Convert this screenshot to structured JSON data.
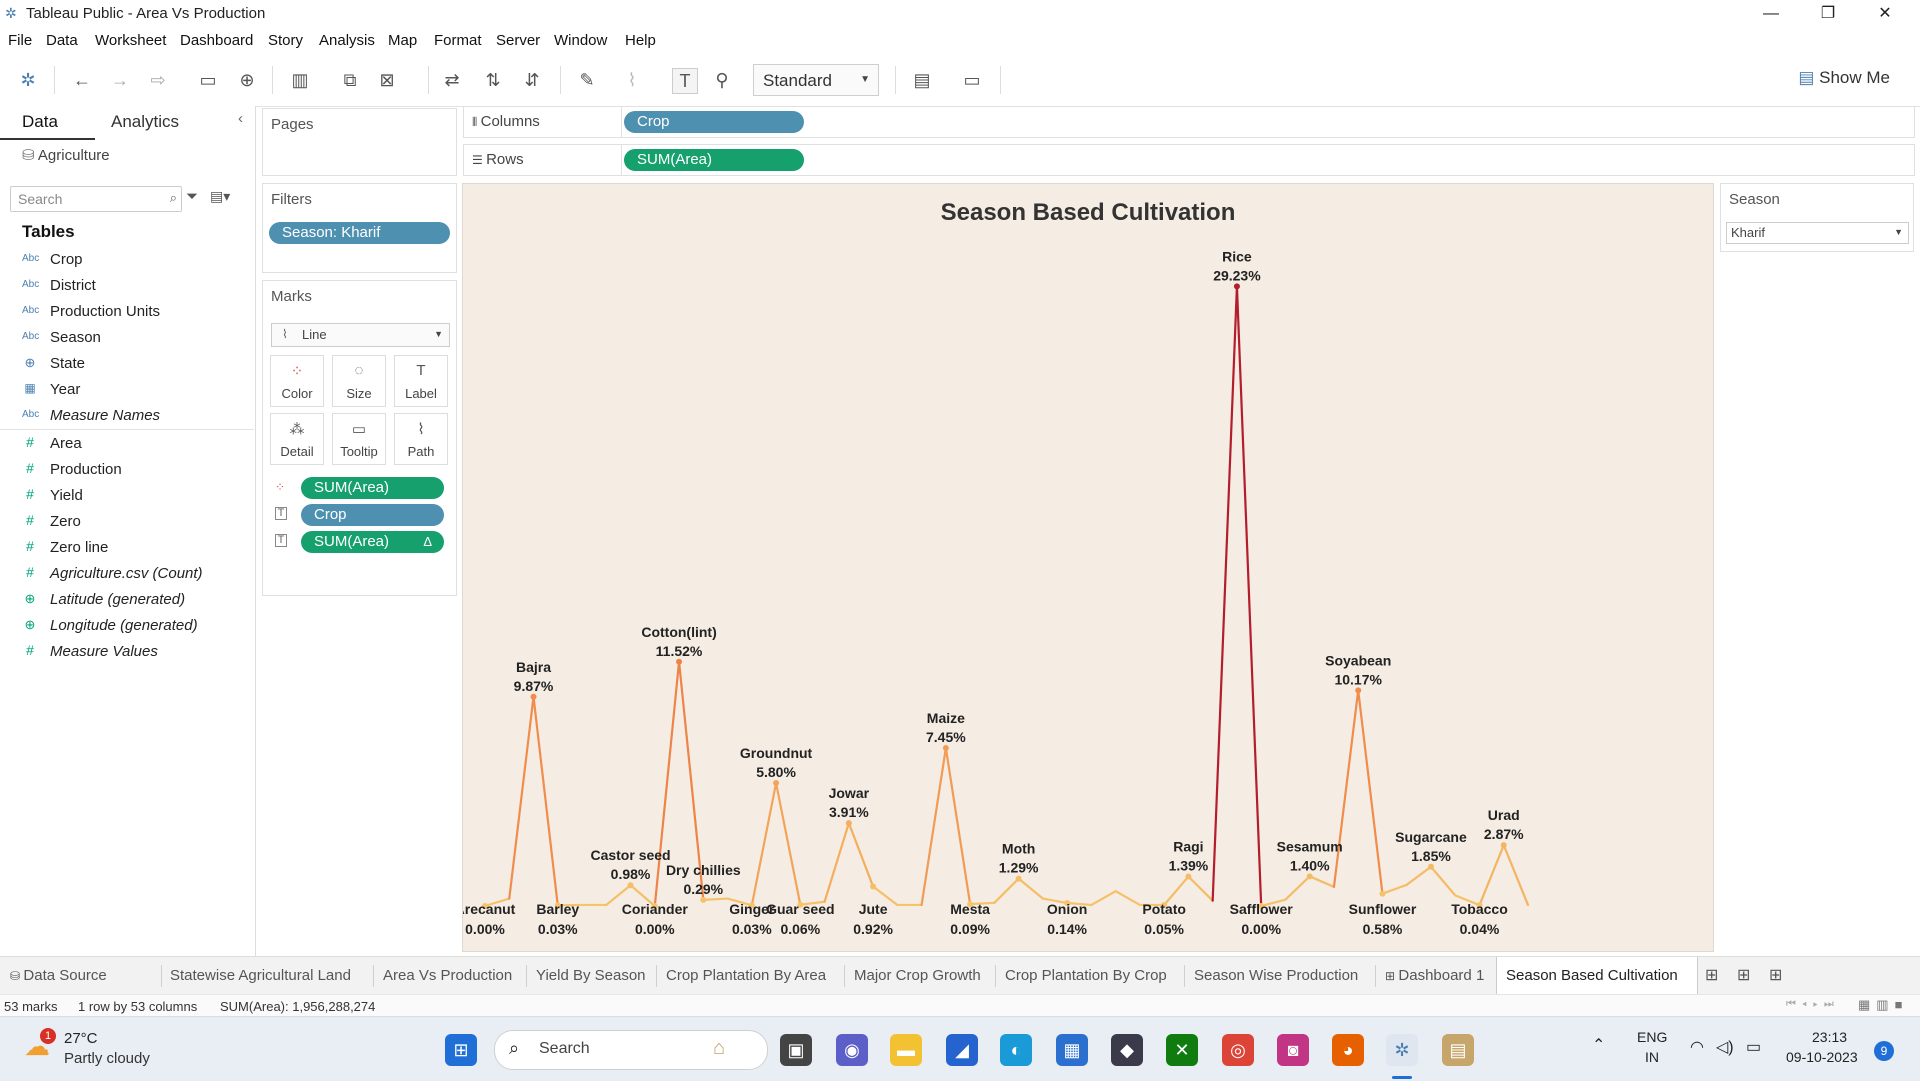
{
  "window": {
    "title": "Tableau Public - Area Vs Production",
    "minimize": "—",
    "restore": "❐",
    "close": "✕"
  },
  "menu": [
    "File",
    "Data",
    "Worksheet",
    "Dashboard",
    "Story",
    "Analysis",
    "Map",
    "Format",
    "Server",
    "Window",
    "Help"
  ],
  "toolbar": {
    "fit_value": "Standard",
    "show_me": "Show Me"
  },
  "data_pane": {
    "tab_data": "Data",
    "tab_analytics": "Analytics",
    "datasource": "Agriculture",
    "search_placeholder": "Search",
    "tables_heading": "Tables",
    "dimensions": [
      {
        "type": "Abc",
        "name": "Crop"
      },
      {
        "type": "Abc",
        "name": "District"
      },
      {
        "type": "Abc",
        "name": "Production Units"
      },
      {
        "type": "Abc",
        "name": "Season"
      },
      {
        "type": "⊕",
        "name": "State"
      },
      {
        "type": "▦",
        "name": "Year"
      },
      {
        "type": "Abc",
        "name": "Measure Names",
        "italic": true
      }
    ],
    "measures": [
      {
        "type": "#",
        "name": "Area"
      },
      {
        "type": "#",
        "name": "Production"
      },
      {
        "type": "#",
        "name": "Yield"
      },
      {
        "type": "#",
        "name": "Zero"
      },
      {
        "type": "#",
        "name": "Zero line"
      },
      {
        "type": "#",
        "name": "Agriculture.csv (Count)",
        "italic": true
      },
      {
        "type": "⊕",
        "name": "Latitude (generated)",
        "italic": true
      },
      {
        "type": "⊕",
        "name": "Longitude (generated)",
        "italic": true
      },
      {
        "type": "#",
        "name": "Measure Values",
        "italic": true
      }
    ]
  },
  "cards": {
    "pages_title": "Pages",
    "filters_title": "Filters",
    "filter_pill": "Season: Kharif",
    "marks_title": "Marks",
    "mark_type": "Line",
    "mark_buttons": [
      "Color",
      "Size",
      "Label",
      "Detail",
      "Tooltip",
      "Path"
    ],
    "mark_pills": [
      {
        "label": "SUM(Area)",
        "color": "green",
        "icon": "color"
      },
      {
        "label": "Crop",
        "color": "blue",
        "icon": "label"
      },
      {
        "label": "SUM(Area)",
        "color": "green",
        "icon": "label",
        "delta": "Δ"
      }
    ]
  },
  "shelves": {
    "columns_label": "Columns",
    "columns_pill": "Crop",
    "rows_label": "Rows",
    "rows_pill": "SUM(Area)"
  },
  "season_control": {
    "title": "Season",
    "value": "Kharif"
  },
  "chart_data": {
    "type": "line",
    "title": "Season Based Cultivation",
    "x": [
      "Arecanut",
      "p1",
      "Bajra",
      "Barley",
      "p2",
      "Castor seed",
      "p3",
      "Coriander",
      "Cotton(lint)",
      "Dry chillies",
      "p4",
      "Ginger",
      "Groundnut",
      "Guar seed",
      "p5",
      "Jowar",
      "Jute",
      "p6",
      "p7",
      "Maize",
      "Mesta",
      "p8",
      "Moth",
      "p9",
      "Onion",
      "p10",
      "p11",
      "p12",
      "Potato",
      "Ragi",
      "p13",
      "Rice",
      "Safflower",
      "p14",
      "Sesamum",
      "p15",
      "Soyabean",
      "Sunflower",
      "p16",
      "Sugarcane",
      "p17",
      "Tobacco",
      "Urad",
      "p18"
    ],
    "values": [
      0.0,
      0.35,
      9.87,
      0.03,
      0.05,
      0.05,
      0.98,
      0.0,
      11.52,
      0.29,
      0.35,
      0.03,
      5.8,
      0.06,
      0.2,
      3.91,
      0.92,
      0.05,
      0.05,
      7.45,
      0.09,
      0.15,
      1.29,
      0.35,
      0.14,
      0.05,
      0.7,
      0.05,
      0.05,
      1.39,
      0.25,
      29.23,
      0.0,
      0.3,
      1.4,
      0.9,
      10.17,
      0.58,
      1.0,
      1.85,
      0.5,
      0.04,
      2.87,
      0.05
    ],
    "labels": [
      {
        "i": 0,
        "name": "Arecanut",
        "pct": "0.00%",
        "pos": "below"
      },
      {
        "i": 2,
        "name": "Bajra",
        "pct": "9.87%",
        "pos": "above"
      },
      {
        "i": 3,
        "name": "Barley",
        "pct": "0.03%",
        "pos": "below"
      },
      {
        "i": 6,
        "name": "Castor seed",
        "pct": "0.98%",
        "pos": "above"
      },
      {
        "i": 7,
        "name": "Coriander",
        "pct": "0.00%",
        "pos": "below"
      },
      {
        "i": 8,
        "name": "Cotton(lint)",
        "pct": "11.52%",
        "pos": "above"
      },
      {
        "i": 9,
        "name": "Dry chillies",
        "pct": "0.29%",
        "pos": "above"
      },
      {
        "i": 11,
        "name": "Ginger",
        "pct": "0.03%",
        "pos": "below"
      },
      {
        "i": 12,
        "name": "Groundnut",
        "pct": "5.80%",
        "pos": "above"
      },
      {
        "i": 13,
        "name": "Guar seed",
        "pct": "0.06%",
        "pos": "below"
      },
      {
        "i": 15,
        "name": "Jowar",
        "pct": "3.91%",
        "pos": "above"
      },
      {
        "i": 16,
        "name": "Jute",
        "pct": "0.92%",
        "pos": "below"
      },
      {
        "i": 19,
        "name": "Maize",
        "pct": "7.45%",
        "pos": "above"
      },
      {
        "i": 20,
        "name": "Mesta",
        "pct": "0.09%",
        "pos": "below"
      },
      {
        "i": 22,
        "name": "Moth",
        "pct": "1.29%",
        "pos": "above"
      },
      {
        "i": 24,
        "name": "Onion",
        "pct": "0.14%",
        "pos": "below"
      },
      {
        "i": 28,
        "name": "Potato",
        "pct": "0.05%",
        "pos": "below"
      },
      {
        "i": 29,
        "name": "Ragi",
        "pct": "1.39%",
        "pos": "above"
      },
      {
        "i": 31,
        "name": "Rice",
        "pct": "29.23%",
        "pos": "above"
      },
      {
        "i": 32,
        "name": "Safflower",
        "pct": "0.00%",
        "pos": "below"
      },
      {
        "i": 34,
        "name": "Sesamum",
        "pct": "1.40%",
        "pos": "above"
      },
      {
        "i": 36,
        "name": "Soyabean",
        "pct": "10.17%",
        "pos": "above"
      },
      {
        "i": 37,
        "name": "Sunflower",
        "pct": "0.58%",
        "pos": "below"
      },
      {
        "i": 39,
        "name": "Sugarcane",
        "pct": "1.85%",
        "pos": "above"
      },
      {
        "i": 41,
        "name": "Tobacco",
        "pct": "0.04%",
        "pos": "below"
      },
      {
        "i": 42,
        "name": "Urad",
        "pct": "2.87%",
        "pos": "above"
      }
    ],
    "ylim": [
      0,
      30
    ],
    "grid": false,
    "colors": {
      "low": "#f6c46a",
      "mid": "#f08a4b",
      "high": "#b2182b"
    }
  },
  "sheet_tabs": [
    "Data Source",
    "Statewise Agricultural Land",
    "Area Vs Production",
    "Yield By Season",
    "Crop Plantation By Area",
    "Major Crop Growth",
    "Crop Plantation By Crop",
    "Season Wise Production",
    "Dashboard 1",
    "Season Based Cultivation"
  ],
  "status": {
    "marks": "53 marks",
    "shape": "1 row by 53 columns",
    "sum": "SUM(Area): 1,956,288,274"
  },
  "taskbar": {
    "weather_temp": "27°C",
    "weather_desc": "Partly cloudy",
    "weather_badge": "1",
    "search_placeholder": "Search",
    "lang1": "ENG",
    "lang2": "IN",
    "time": "23:13",
    "date": "09-10-2023",
    "notif_count": "9"
  }
}
